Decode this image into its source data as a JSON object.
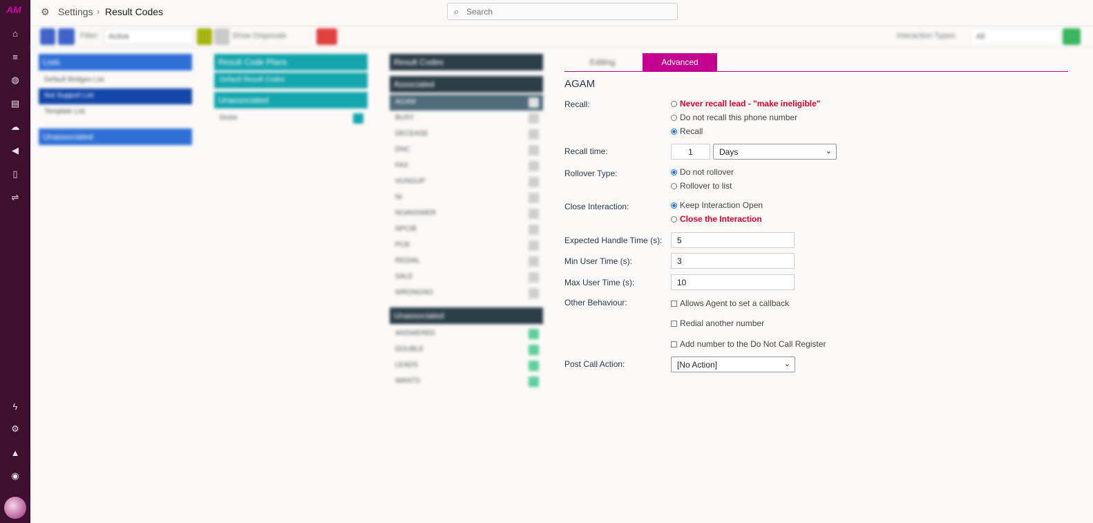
{
  "sidebar": {
    "logo": "AM",
    "icons": [
      "home-icon",
      "list-icon",
      "globe-icon",
      "database-icon",
      "cloud-icon",
      "megaphone-icon",
      "document-icon",
      "link-icon",
      "lightning-icon",
      "gear-icon",
      "bell-icon",
      "help-icon"
    ]
  },
  "header": {
    "breadcrumb_root": "Settings",
    "breadcrumb_sep": "›",
    "breadcrumb_current": "Result Codes",
    "search_placeholder": "Search"
  },
  "toolbar": {
    "filter_label": "Filter:",
    "filter_value": "Active",
    "show_label": "Show Disposals",
    "interaction_label": "Interaction Types:",
    "interaction_value": "All"
  },
  "columns": {
    "lists": {
      "header": "Lists",
      "items": [
        "Default Bridges List",
        "Not Support List",
        "Template List"
      ],
      "unassoc_header": "Unassociated"
    },
    "plans": {
      "header": "Result Code Plans",
      "items": [
        "Default Result Codes"
      ],
      "unassoc_header": "Unassociated",
      "unassoc_items": [
        "Dozie"
      ]
    },
    "codes": {
      "header": "Result Codes",
      "assoc_header": "Associated",
      "selected": "AGAM",
      "items": [
        "BUSY",
        "DECEASE",
        "DNC",
        "FAX",
        "HUNGUP",
        "NI",
        "NOANSWER",
        "NPCIB",
        "PCB",
        "REDIAL",
        "SALE",
        "WRONGNO"
      ],
      "unassoc_header": "Unassociated",
      "unassoc_items": [
        "ANSWERED",
        "DOUBLE",
        "LEADS",
        "WANTS"
      ]
    }
  },
  "tabs": {
    "editing": "Editing",
    "advanced": "Advanced"
  },
  "panel": {
    "title": "AGAM",
    "recall_label": "Recall:",
    "recall_options": [
      "Never recall lead - \"make ineligible\"",
      "Do not recall this phone number",
      "Recall"
    ],
    "recall_time_label": "Recall time:",
    "recall_time_value": "1",
    "recall_time_unit": "Days",
    "rollover_label": "Rollover Type:",
    "rollover_options": [
      "Do not rollover",
      "Rollover to list"
    ],
    "close_label": "Close Interaction:",
    "close_options": [
      "Keep Interaction Open",
      "Close the Interaction"
    ],
    "eht_label": "Expected Handle Time (s):",
    "eht_value": "5",
    "min_label": "Min User Time (s):",
    "min_value": "3",
    "max_label": "Max User Time (s):",
    "max_value": "10",
    "other_label": "Other Behaviour:",
    "other_options": [
      "Allows Agent to set a callback",
      "Redial another number",
      "Add number to the Do Not Call Register"
    ],
    "post_label": "Post Call Action:",
    "post_value": "[No Action]"
  },
  "colors": {
    "accent": "#c4008e",
    "sidebar": "#3d1030",
    "danger": "#e0002a"
  }
}
